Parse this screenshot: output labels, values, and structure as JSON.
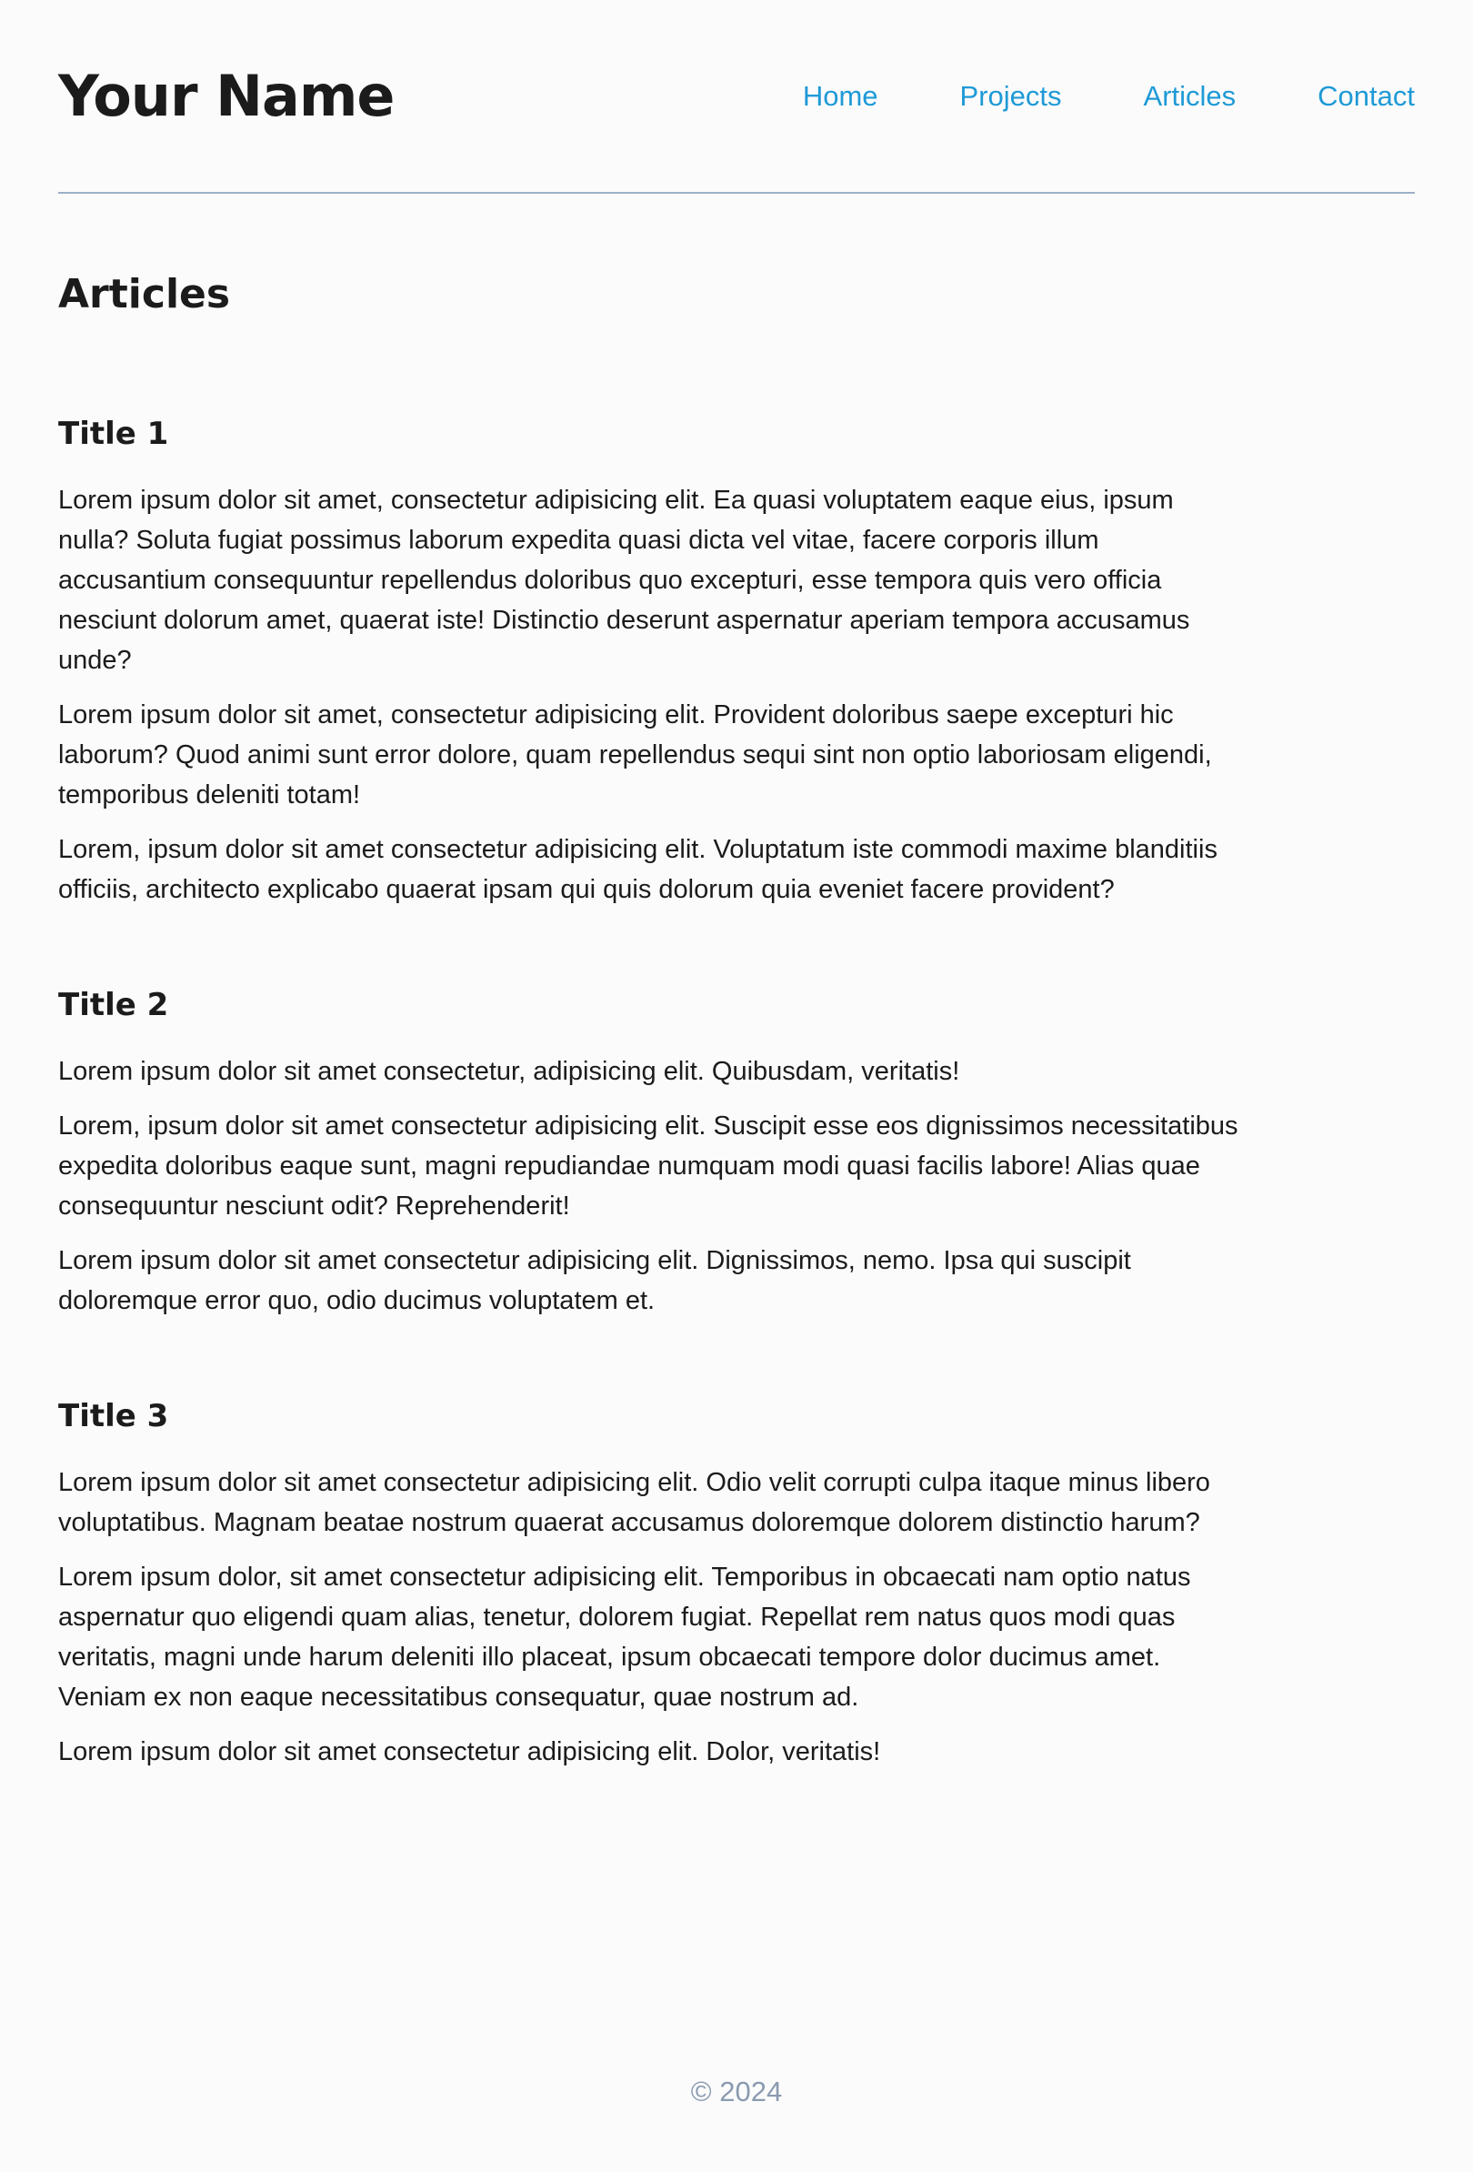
{
  "header": {
    "site_title": "Your Name",
    "nav": [
      "Home",
      "Projects",
      "Articles",
      "Contact"
    ]
  },
  "main": {
    "heading": "Articles",
    "articles": [
      {
        "title": "Title 1",
        "paragraphs": [
          "Lorem ipsum dolor sit amet, consectetur adipisicing elit. Ea quasi voluptatem eaque eius, ipsum nulla? Soluta fugiat possimus laborum expedita quasi dicta vel vitae, facere corporis illum accusantium consequuntur repellendus doloribus quo excepturi, esse tempora quis vero officia nesciunt dolorum amet, quaerat iste! Distinctio deserunt aspernatur aperiam tempora accusamus unde?",
          "Lorem ipsum dolor sit amet, consectetur adipisicing elit. Provident doloribus saepe excepturi hic laborum? Quod animi sunt error dolore, quam repellendus sequi sint non optio laboriosam eligendi, temporibus deleniti totam!",
          "Lorem, ipsum dolor sit amet consectetur adipisicing elit. Voluptatum iste commodi maxime blanditiis officiis, architecto explicabo quaerat ipsam qui quis dolorum quia eveniet facere provident?"
        ]
      },
      {
        "title": "Title 2",
        "paragraphs": [
          "Lorem ipsum dolor sit amet consectetur, adipisicing elit. Quibusdam, veritatis!",
          "Lorem, ipsum dolor sit amet consectetur adipisicing elit. Suscipit esse eos dignissimos necessitatibus expedita doloribus eaque sunt, magni repudiandae numquam modi quasi facilis labore! Alias quae consequuntur nesciunt odit? Reprehenderit!",
          "Lorem ipsum dolor sit amet consectetur adipisicing elit. Dignissimos, nemo. Ipsa qui suscipit doloremque error quo, odio ducimus voluptatem et."
        ]
      },
      {
        "title": "Title 3",
        "paragraphs": [
          "Lorem ipsum dolor sit amet consectetur adipisicing elit. Odio velit corrupti culpa itaque minus libero voluptatibus. Magnam beatae nostrum quaerat accusamus doloremque dolorem distinctio harum?",
          "Lorem ipsum dolor, sit amet consectetur adipisicing elit. Temporibus in obcaecati nam optio natus aspernatur quo eligendi quam alias, tenetur, dolorem fugiat. Repellat rem natus quos modi quas veritatis, magni unde harum deleniti illo placeat, ipsum obcaecati tempore dolor ducimus amet. Veniam ex non eaque necessitatibus consequatur, quae nostrum ad.",
          "Lorem ipsum dolor sit amet consectetur adipisicing elit. Dolor, veritatis!"
        ]
      }
    ]
  },
  "footer": {
    "copyright": "© 2024"
  },
  "colors": {
    "link": "#1e9ad6",
    "divider": "#9cb0c6",
    "footer_text": "#8a9ab0",
    "background": "#fbfbfc"
  }
}
